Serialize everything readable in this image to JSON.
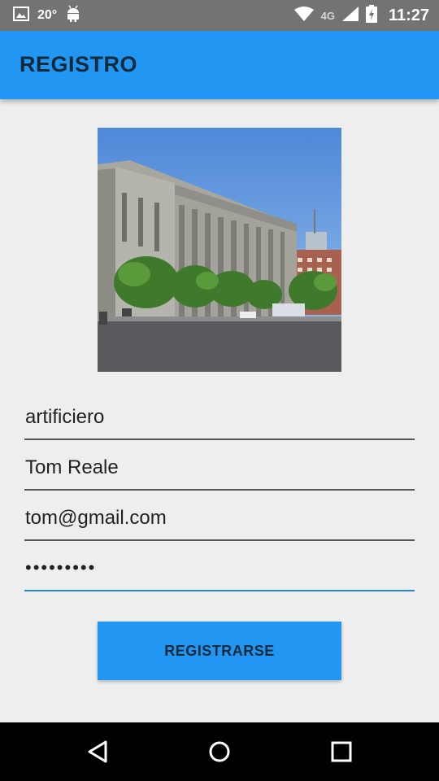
{
  "status_bar": {
    "temperature": "20°",
    "network_label": "4G",
    "time": "11:27",
    "icons": [
      "image-icon",
      "android-icon",
      "wifi-icon",
      "signal-icon",
      "battery-icon"
    ]
  },
  "app_bar": {
    "title": "REGISTRO"
  },
  "form": {
    "username": "artificiero",
    "name": "Tom Reale",
    "email": "tom@gmail.com",
    "password_masked": "•••••••••"
  },
  "button": {
    "label": "REGISTRARSE"
  },
  "nav_bar": {
    "icons": [
      "back-icon",
      "home-icon",
      "recents-icon"
    ]
  },
  "colors": {
    "primary": "#2196f3",
    "status_bar": "#737373",
    "background": "#eeeeee",
    "focus_underline": "#1e88e5"
  }
}
